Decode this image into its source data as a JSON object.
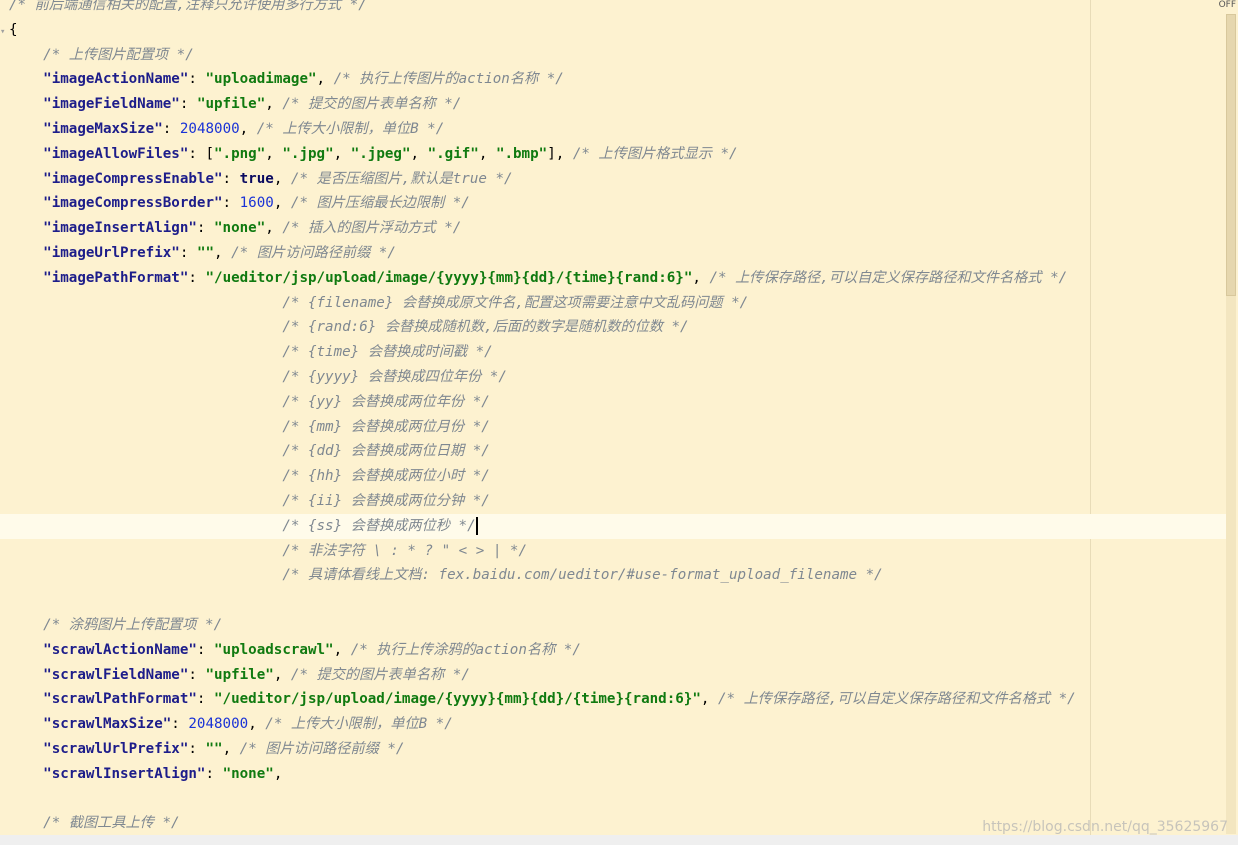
{
  "editor": {
    "lines": [
      {
        "tokens": [
          {
            "t": "c",
            "v": "/* 前后端通信相关的配置,注释只允许使用多行方式 */"
          }
        ]
      },
      {
        "tokens": [
          {
            "t": "p",
            "v": "{"
          }
        ]
      },
      {
        "tokens": [
          {
            "t": "p",
            "v": "    "
          },
          {
            "t": "c",
            "v": "/* 上传图片配置项 */"
          }
        ]
      },
      {
        "tokens": [
          {
            "t": "p",
            "v": "    "
          },
          {
            "t": "k",
            "v": "\"imageActionName\""
          },
          {
            "t": "p",
            "v": ": "
          },
          {
            "t": "s",
            "v": "\"uploadimage\""
          },
          {
            "t": "p",
            "v": ", "
          },
          {
            "t": "c",
            "v": "/* 执行上传图片的action名称 */"
          }
        ]
      },
      {
        "tokens": [
          {
            "t": "p",
            "v": "    "
          },
          {
            "t": "k",
            "v": "\"imageFieldName\""
          },
          {
            "t": "p",
            "v": ": "
          },
          {
            "t": "s",
            "v": "\"upfile\""
          },
          {
            "t": "p",
            "v": ", "
          },
          {
            "t": "c",
            "v": "/* 提交的图片表单名称 */"
          }
        ]
      },
      {
        "tokens": [
          {
            "t": "p",
            "v": "    "
          },
          {
            "t": "k",
            "v": "\"imageMaxSize\""
          },
          {
            "t": "p",
            "v": ": "
          },
          {
            "t": "n",
            "v": "2048000"
          },
          {
            "t": "p",
            "v": ", "
          },
          {
            "t": "c",
            "v": "/* 上传大小限制，单位B */"
          }
        ]
      },
      {
        "tokens": [
          {
            "t": "p",
            "v": "    "
          },
          {
            "t": "k",
            "v": "\"imageAllowFiles\""
          },
          {
            "t": "p",
            "v": ": ["
          },
          {
            "t": "s",
            "v": "\".png\""
          },
          {
            "t": "p",
            "v": ", "
          },
          {
            "t": "s",
            "v": "\".jpg\""
          },
          {
            "t": "p",
            "v": ", "
          },
          {
            "t": "s",
            "v": "\".jpeg\""
          },
          {
            "t": "p",
            "v": ", "
          },
          {
            "t": "s",
            "v": "\".gif\""
          },
          {
            "t": "p",
            "v": ", "
          },
          {
            "t": "s",
            "v": "\".bmp\""
          },
          {
            "t": "p",
            "v": "], "
          },
          {
            "t": "c",
            "v": "/* 上传图片格式显示 */"
          }
        ]
      },
      {
        "tokens": [
          {
            "t": "p",
            "v": "    "
          },
          {
            "t": "k",
            "v": "\"imageCompressEnable\""
          },
          {
            "t": "p",
            "v": ": "
          },
          {
            "t": "kw",
            "v": "true"
          },
          {
            "t": "p",
            "v": ", "
          },
          {
            "t": "c",
            "v": "/* 是否压缩图片,默认是true */"
          }
        ]
      },
      {
        "tokens": [
          {
            "t": "p",
            "v": "    "
          },
          {
            "t": "k",
            "v": "\"imageCompressBorder\""
          },
          {
            "t": "p",
            "v": ": "
          },
          {
            "t": "n",
            "v": "1600"
          },
          {
            "t": "p",
            "v": ", "
          },
          {
            "t": "c",
            "v": "/* 图片压缩最长边限制 */"
          }
        ]
      },
      {
        "tokens": [
          {
            "t": "p",
            "v": "    "
          },
          {
            "t": "k",
            "v": "\"imageInsertAlign\""
          },
          {
            "t": "p",
            "v": ": "
          },
          {
            "t": "s",
            "v": "\"none\""
          },
          {
            "t": "p",
            "v": ", "
          },
          {
            "t": "c",
            "v": "/* 插入的图片浮动方式 */"
          }
        ]
      },
      {
        "tokens": [
          {
            "t": "p",
            "v": "    "
          },
          {
            "t": "k",
            "v": "\"imageUrlPrefix\""
          },
          {
            "t": "p",
            "v": ": "
          },
          {
            "t": "s",
            "v": "\"\""
          },
          {
            "t": "p",
            "v": ", "
          },
          {
            "t": "c",
            "v": "/* 图片访问路径前缀 */"
          }
        ]
      },
      {
        "tokens": [
          {
            "t": "p",
            "v": "    "
          },
          {
            "t": "k",
            "v": "\"imagePathFormat\""
          },
          {
            "t": "p",
            "v": ": "
          },
          {
            "t": "s",
            "v": "\"/ueditor/jsp/upload/image/{yyyy}{mm}{dd}/{time}{rand:6}\""
          },
          {
            "t": "p",
            "v": ", "
          },
          {
            "t": "c",
            "v": "/* 上传保存路径,可以自定义保存路径和文件名格式 */"
          }
        ]
      },
      {
        "tokens": [
          {
            "t": "p",
            "v": "                                "
          },
          {
            "t": "c",
            "v": "/* {filename} 会替换成原文件名,配置这项需要注意中文乱码问题 */"
          }
        ]
      },
      {
        "tokens": [
          {
            "t": "p",
            "v": "                                "
          },
          {
            "t": "c",
            "v": "/* {rand:6} 会替换成随机数,后面的数字是随机数的位数 */"
          }
        ]
      },
      {
        "tokens": [
          {
            "t": "p",
            "v": "                                "
          },
          {
            "t": "c",
            "v": "/* {time} 会替换成时间戳 */"
          }
        ]
      },
      {
        "tokens": [
          {
            "t": "p",
            "v": "                                "
          },
          {
            "t": "c",
            "v": "/* {yyyy} 会替换成四位年份 */"
          }
        ]
      },
      {
        "tokens": [
          {
            "t": "p",
            "v": "                                "
          },
          {
            "t": "c",
            "v": "/* {yy} 会替换成两位年份 */"
          }
        ]
      },
      {
        "tokens": [
          {
            "t": "p",
            "v": "                                "
          },
          {
            "t": "c",
            "v": "/* {mm} 会替换成两位月份 */"
          }
        ]
      },
      {
        "tokens": [
          {
            "t": "p",
            "v": "                                "
          },
          {
            "t": "c",
            "v": "/* {dd} 会替换成两位日期 */"
          }
        ]
      },
      {
        "tokens": [
          {
            "t": "p",
            "v": "                                "
          },
          {
            "t": "c",
            "v": "/* {hh} 会替换成两位小时 */"
          }
        ]
      },
      {
        "tokens": [
          {
            "t": "p",
            "v": "                                "
          },
          {
            "t": "c",
            "v": "/* {ii} 会替换成两位分钟 */"
          }
        ]
      },
      {
        "current": true,
        "tokens": [
          {
            "t": "p",
            "v": "                                "
          },
          {
            "t": "c",
            "v": "/* {ss} 会替换成两位秒 */"
          }
        ]
      },
      {
        "tokens": [
          {
            "t": "p",
            "v": "                                "
          },
          {
            "t": "c",
            "v": "/* 非法字符 \\ : * ? \" < > | */"
          }
        ]
      },
      {
        "tokens": [
          {
            "t": "p",
            "v": "                                "
          },
          {
            "t": "c",
            "v": "/* 具请体看线上文档: fex.baidu.com/ueditor/#use-format_upload_filename */"
          }
        ]
      },
      {
        "tokens": []
      },
      {
        "tokens": [
          {
            "t": "p",
            "v": "    "
          },
          {
            "t": "c",
            "v": "/* 涂鸦图片上传配置项 */"
          }
        ]
      },
      {
        "tokens": [
          {
            "t": "p",
            "v": "    "
          },
          {
            "t": "k",
            "v": "\"scrawlActionName\""
          },
          {
            "t": "p",
            "v": ": "
          },
          {
            "t": "s",
            "v": "\"uploadscrawl\""
          },
          {
            "t": "p",
            "v": ", "
          },
          {
            "t": "c",
            "v": "/* 执行上传涂鸦的action名称 */"
          }
        ]
      },
      {
        "tokens": [
          {
            "t": "p",
            "v": "    "
          },
          {
            "t": "k",
            "v": "\"scrawlFieldName\""
          },
          {
            "t": "p",
            "v": ": "
          },
          {
            "t": "s",
            "v": "\"upfile\""
          },
          {
            "t": "p",
            "v": ", "
          },
          {
            "t": "c",
            "v": "/* 提交的图片表单名称 */"
          }
        ]
      },
      {
        "tokens": [
          {
            "t": "p",
            "v": "    "
          },
          {
            "t": "k",
            "v": "\"scrawlPathFormat\""
          },
          {
            "t": "p",
            "v": ": "
          },
          {
            "t": "s",
            "v": "\"/ueditor/jsp/upload/image/{yyyy}{mm}{dd}/{time}{rand:6}\""
          },
          {
            "t": "p",
            "v": ", "
          },
          {
            "t": "c",
            "v": "/* 上传保存路径,可以自定义保存路径和文件名格式 */"
          }
        ]
      },
      {
        "tokens": [
          {
            "t": "p",
            "v": "    "
          },
          {
            "t": "k",
            "v": "\"scrawlMaxSize\""
          },
          {
            "t": "p",
            "v": ": "
          },
          {
            "t": "n",
            "v": "2048000"
          },
          {
            "t": "p",
            "v": ", "
          },
          {
            "t": "c",
            "v": "/* 上传大小限制，单位B */"
          }
        ]
      },
      {
        "tokens": [
          {
            "t": "p",
            "v": "    "
          },
          {
            "t": "k",
            "v": "\"scrawlUrlPrefix\""
          },
          {
            "t": "p",
            "v": ": "
          },
          {
            "t": "s",
            "v": "\"\""
          },
          {
            "t": "p",
            "v": ", "
          },
          {
            "t": "c",
            "v": "/* 图片访问路径前缀 */"
          }
        ]
      },
      {
        "tokens": [
          {
            "t": "p",
            "v": "    "
          },
          {
            "t": "k",
            "v": "\"scrawlInsertAlign\""
          },
          {
            "t": "p",
            "v": ": "
          },
          {
            "t": "s",
            "v": "\"none\""
          },
          {
            "t": "p",
            "v": ","
          }
        ]
      },
      {
        "tokens": []
      },
      {
        "tokens": [
          {
            "t": "p",
            "v": "    "
          },
          {
            "t": "c",
            "v": "/* 截图工具上传 */"
          }
        ]
      }
    ]
  },
  "scrollbar": {
    "label": "OFF"
  },
  "watermark": "https://blog.csdn.net/qq_35625967",
  "colors": {
    "background": "#fdf2d0",
    "comment": "#7f8891",
    "key": "#1d1d8a",
    "string": "#107a10",
    "number": "#1a33d6"
  }
}
